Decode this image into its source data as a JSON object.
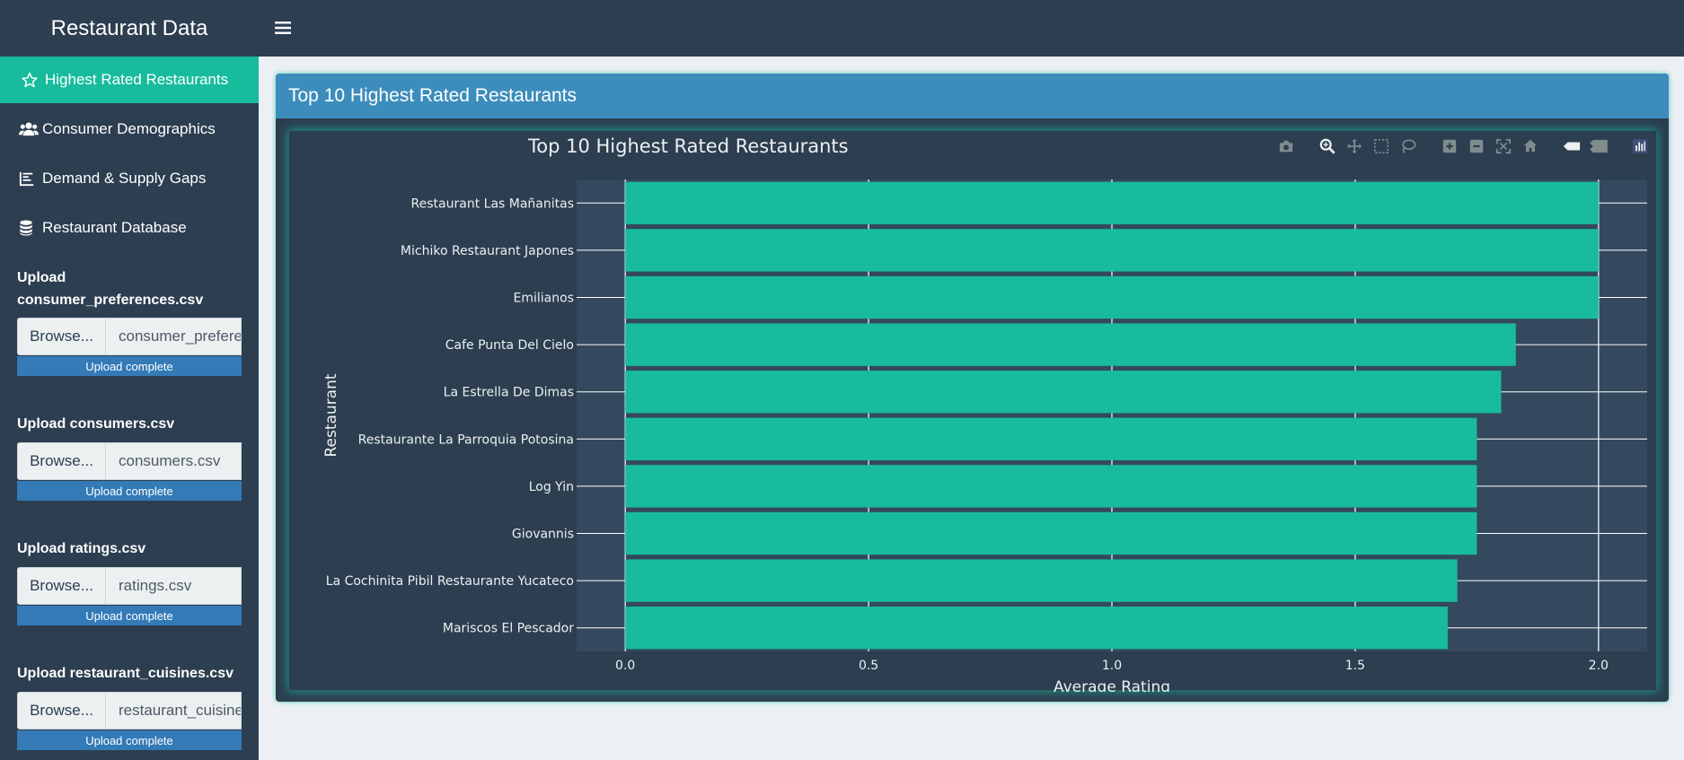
{
  "header": {
    "title": "Restaurant Data",
    "menu_icon": "hamburger-icon"
  },
  "sidebar": {
    "menu": [
      {
        "label": "Highest Rated Restaurants",
        "icon": "star-icon",
        "active": true
      },
      {
        "label": "Consumer Demographics",
        "icon": "users-icon",
        "active": false
      },
      {
        "label": "Demand & Supply Gaps",
        "icon": "chart-icon",
        "active": false
      },
      {
        "label": "Restaurant Database",
        "icon": "database-icon",
        "active": false
      }
    ],
    "uploads": [
      {
        "label": "Upload consumer_preferences.csv",
        "browse": "Browse...",
        "file": "consumer_preferences.csv",
        "status": "Upload complete"
      },
      {
        "label": "Upload consumers.csv",
        "browse": "Browse...",
        "file": "consumers.csv",
        "status": "Upload complete"
      },
      {
        "label": "Upload ratings.csv",
        "browse": "Browse...",
        "file": "ratings.csv",
        "status": "Upload complete"
      },
      {
        "label": "Upload restaurant_cuisines.csv",
        "browse": "Browse...",
        "file": "restaurant_cuisines.csv",
        "status": "Upload complete"
      }
    ]
  },
  "main": {
    "box_title": "Top 10 Highest Rated Restaurants"
  },
  "colors": {
    "bar": "#18bc9c",
    "panel": "#2c3e50",
    "header_blue": "#3c8dbc",
    "active": "#18bc9c"
  },
  "chart_data": {
    "type": "bar",
    "orientation": "horizontal",
    "title": "Top 10 Highest Rated Restaurants",
    "xlabel": "Average Rating",
    "ylabel": "Restaurant",
    "xlim": [
      -0.1,
      2.1
    ],
    "xticks": [
      "0.0",
      "0.5",
      "1.0",
      "1.5",
      "2.0"
    ],
    "grid": true,
    "categories": [
      "Restaurant Las Mañanitas",
      "Michiko Restaurant Japones",
      "Emilianos",
      "Cafe Punta Del Cielo",
      "La Estrella De Dimas",
      "Restaurante La Parroquia Potosina",
      "Log Yin",
      "Giovannis",
      "La Cochinita Pibil Restaurante Yucateco",
      "Mariscos El Pescador"
    ],
    "values": [
      2.0,
      2.0,
      2.0,
      1.83,
      1.8,
      1.75,
      1.75,
      1.75,
      1.71,
      1.69
    ]
  }
}
